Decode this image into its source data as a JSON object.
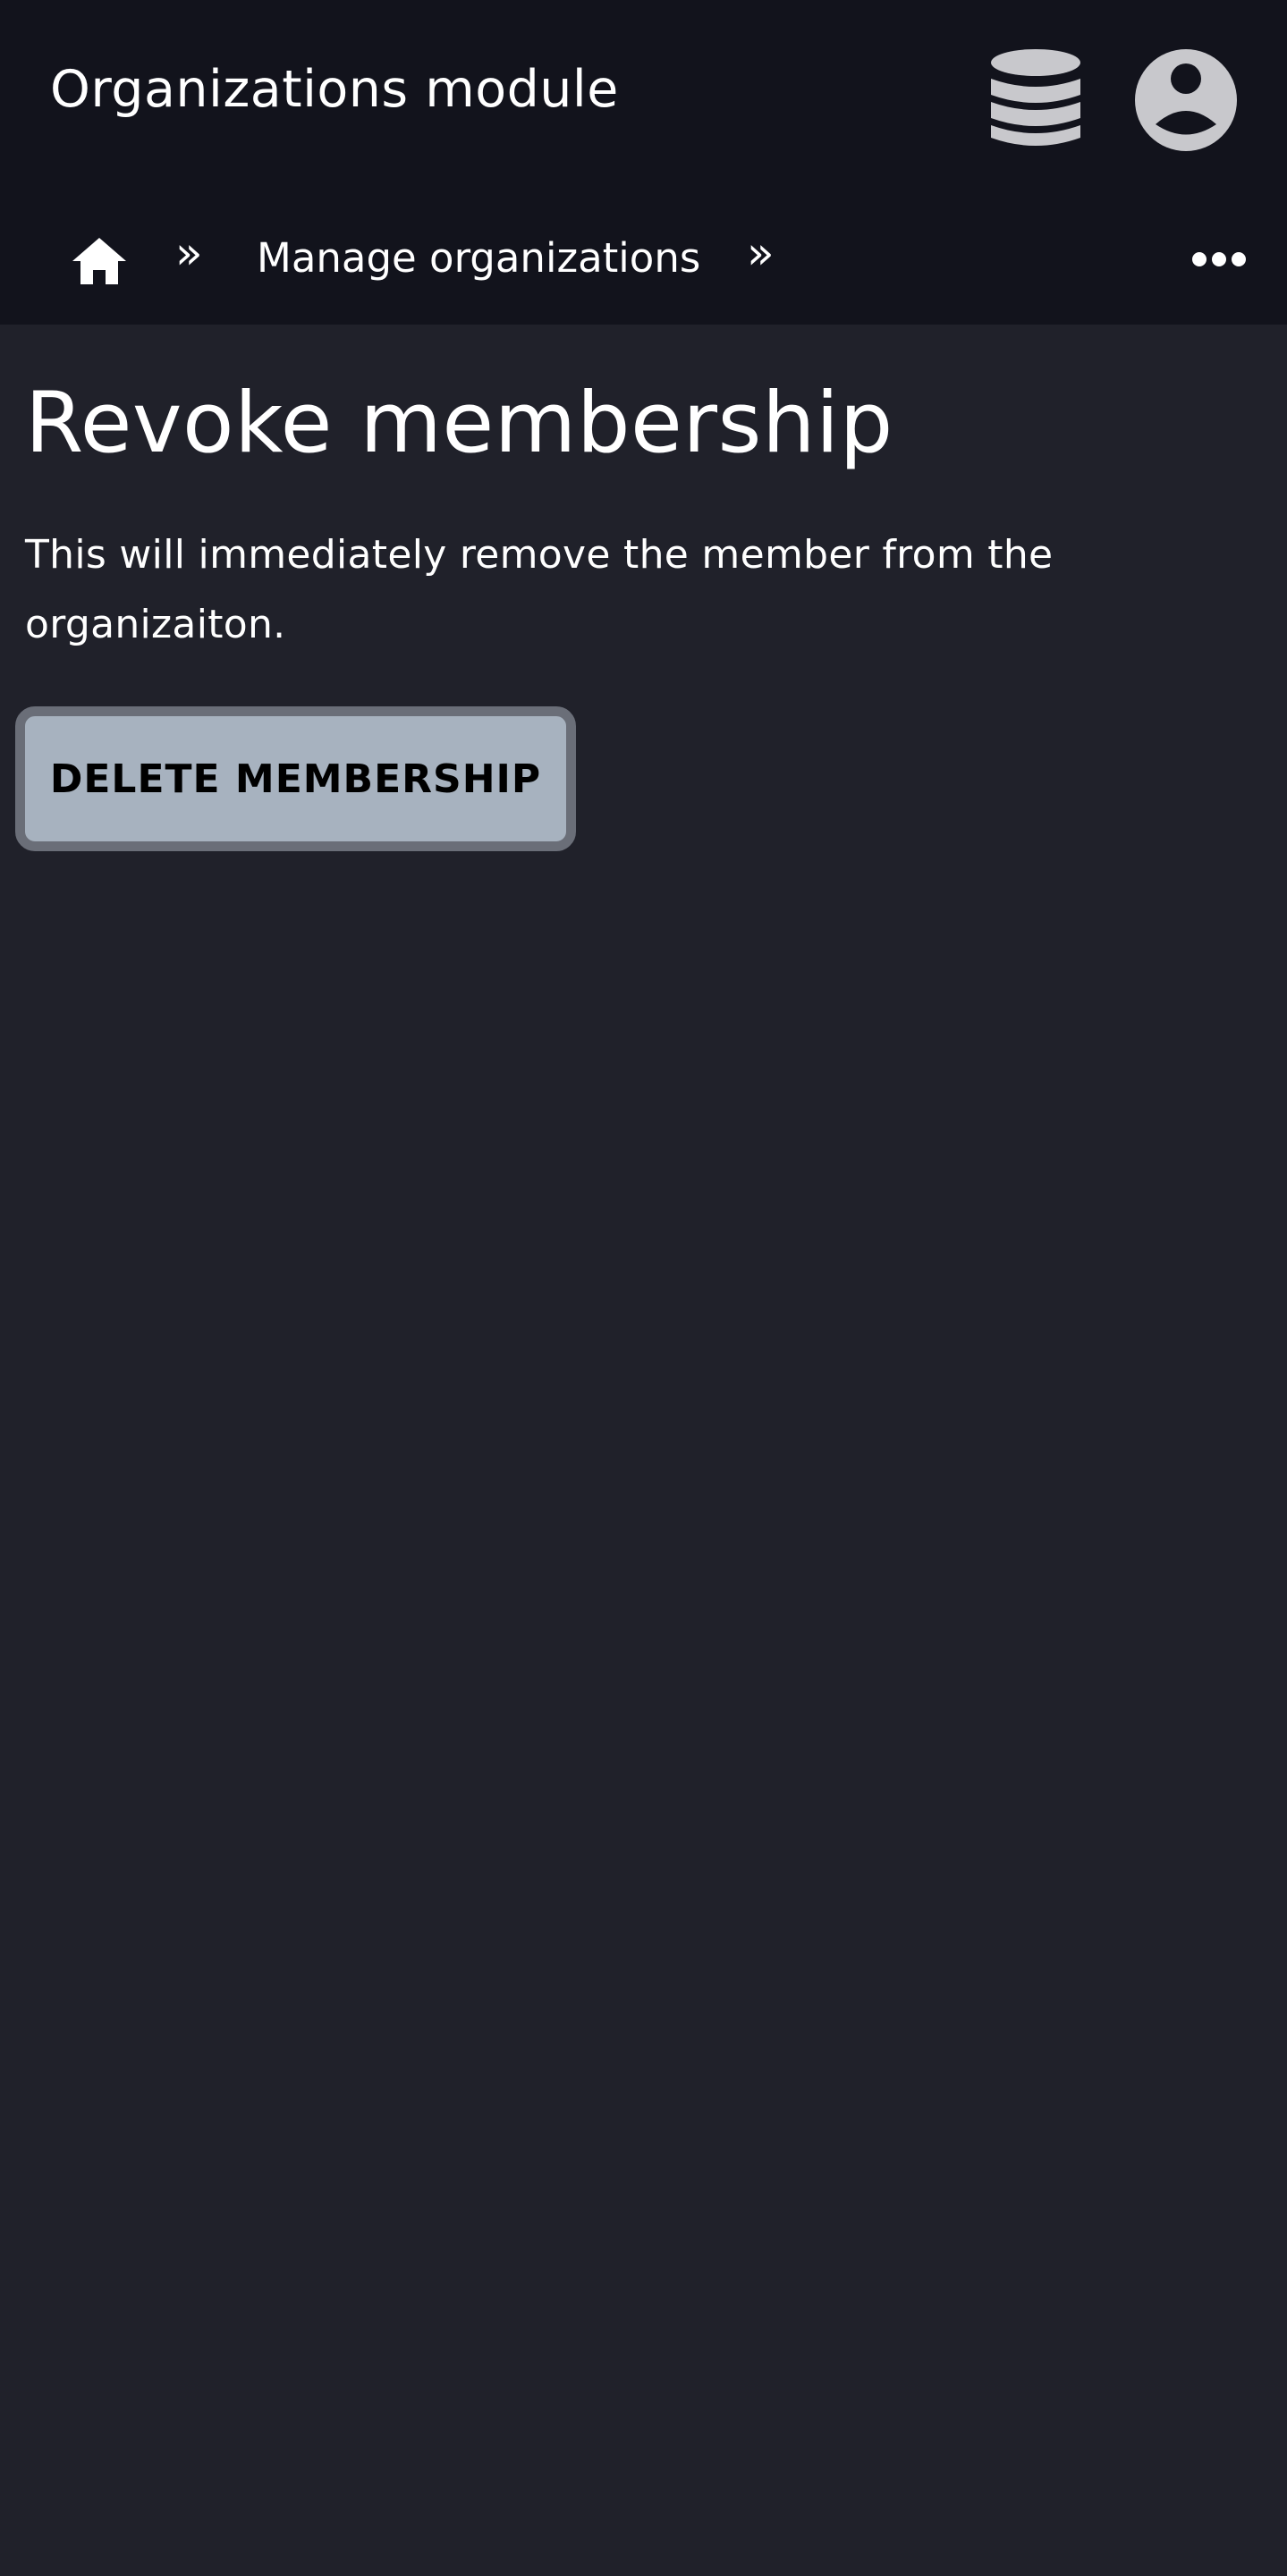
{
  "header": {
    "title": "Organizations module",
    "icons": [
      "database-icon",
      "account-circle-icon"
    ]
  },
  "breadcrumb": {
    "home_icon": "home-icon",
    "separator": "»",
    "items": [
      "Manage organizations"
    ],
    "overflow_icon": "more-horizontal-icon"
  },
  "main": {
    "title": "Revoke membership",
    "description": "This will immediately remove the member from the organizaiton.",
    "delete_button_label": "DELETE MEMBERSHIP"
  },
  "colors": {
    "page_background": "#20212a",
    "header_background": "#12131c",
    "button_background": "#a7b2bf",
    "button_border": "#6a6e78",
    "icon_gray": "#c8c8cc"
  }
}
